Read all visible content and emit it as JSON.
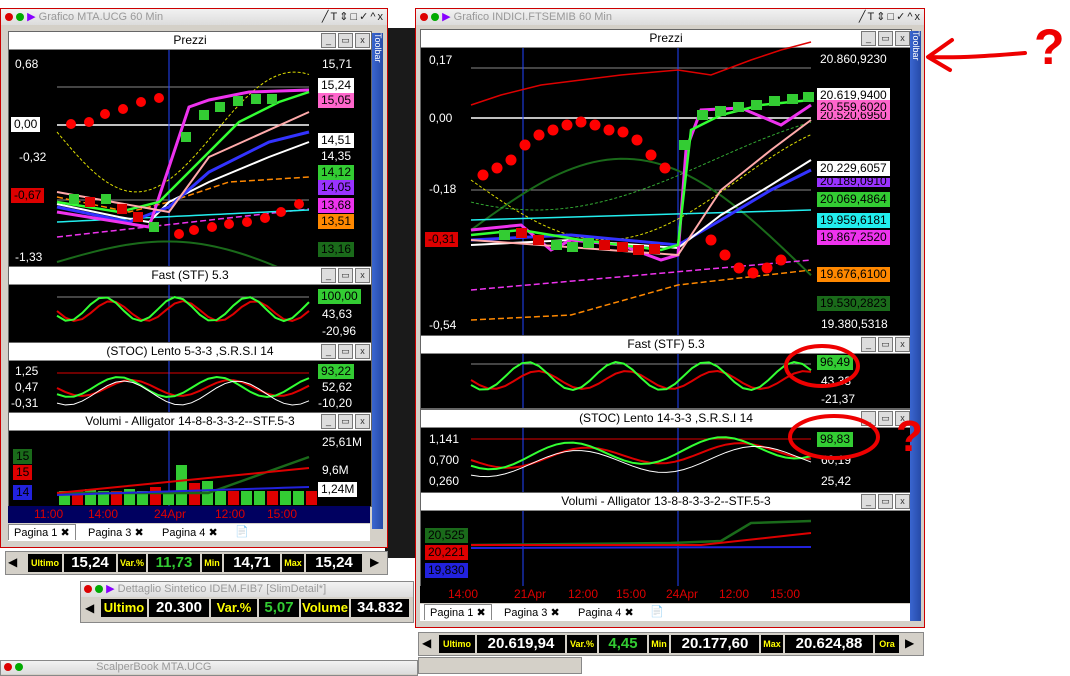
{
  "left_window": {
    "title": "Grafico MTA.UCG 60 Min",
    "toolbar_label": "Toolbar",
    "price_panel": {
      "title": "Prezzi",
      "left_axis": [
        "0,68",
        "0,00",
        "-0,32",
        "-0,67",
        "-1,33"
      ],
      "right_axis": [
        "15,71",
        "15,24",
        "15,05",
        "14,51",
        "14,35",
        "14,12",
        "14,05",
        "13,68",
        "13,51",
        "13,16"
      ]
    },
    "fast_panel": {
      "title": "Fast  (STF)   5.3",
      "values": [
        "100,00",
        "43,63",
        "-20,96"
      ]
    },
    "stoc_panel": {
      "title": "(STOC) Lento    5-3-3 ,S.R.S.I 14",
      "left": [
        "1,25",
        "0,47",
        "-0,31"
      ],
      "right": [
        "93,22",
        "52,62",
        "-10,20"
      ]
    },
    "volume_panel": {
      "title": "Volumi - Alligator 14-8-8-3-3-2--STF.5-3",
      "legend": [
        "15",
        "15",
        "14"
      ],
      "right": [
        "25,61M",
        "9,6M",
        "1,24M"
      ]
    },
    "time_axis": [
      "11:00",
      "14:00",
      "24Apr",
      "12:00",
      "15:00"
    ],
    "tabs": [
      "Pagina 1",
      "Pagina 3",
      "Pagina 4"
    ]
  },
  "right_window": {
    "title": "Grafico INDICI.FTSEMIB 60 Min",
    "toolbar_label": "Toolbar",
    "price_panel": {
      "title": "Prezzi",
      "left_axis": [
        "0,17",
        "0,00",
        "-0,18",
        "-0,31",
        "-0,54"
      ],
      "right_axis": [
        "20.860,9230",
        "20.619,9400",
        "20.559,6020",
        "20.520,6950",
        "20.229,6057",
        "20.189,0910",
        "20.069,4864",
        "19.959,6181",
        "19.867,2520",
        "19.676,6100",
        "19.530,2823",
        "19.380,5318"
      ]
    },
    "fast_panel": {
      "title": "Fast  (STF)   5.3",
      "values": [
        "96,49",
        "43,33",
        "-21,37"
      ]
    },
    "stoc_panel": {
      "title": "(STOC) Lento    14-3-3 ,S.R.S.I 14",
      "left": [
        "1,141",
        "0,700",
        "0,260"
      ],
      "right": [
        "98,83",
        "60,19",
        "25,42"
      ]
    },
    "volume_panel": {
      "title": "Volumi - Alligator 13-8-8-3-3-2--STF.5-3",
      "legend": [
        "20,525",
        "20,221",
        "19,830"
      ]
    },
    "time_axis": [
      "14:00",
      "21Apr",
      "12:00",
      "15:00",
      "24Apr",
      "12:00",
      "15:00"
    ],
    "tabs": [
      "Pagina 1",
      "Pagina 3",
      "Pagina 4"
    ]
  },
  "left_quote": {
    "ultimo_label": "Ultimo",
    "ultimo": "15,24",
    "var_label": "Var.%",
    "var": "11,73",
    "min_label": "Min",
    "min": "14,71",
    "max_label": "Max",
    "max": "15,24"
  },
  "right_quote": {
    "ultimo_label": "Ultimo",
    "ultimo": "20.619,94",
    "var_label": "Var.%",
    "var": "4,45",
    "min_label": "Min",
    "min": "20.177,60",
    "max_label": "Max",
    "max": "20.624,88",
    "ora_label": "Ora"
  },
  "detail_window": {
    "title": "Dettaglio Sintetico IDEM.FIB7 [SlimDetail*]",
    "ultimo_label": "Ultimo",
    "ultimo": "20.300",
    "var_label": "Var.%",
    "var": "5,07",
    "volume_label": "Volume",
    "volume": "34.832"
  },
  "scalper_window": {
    "title": "ScalperBook MTA.UCG"
  },
  "annotations": {
    "question_mark": "?"
  }
}
